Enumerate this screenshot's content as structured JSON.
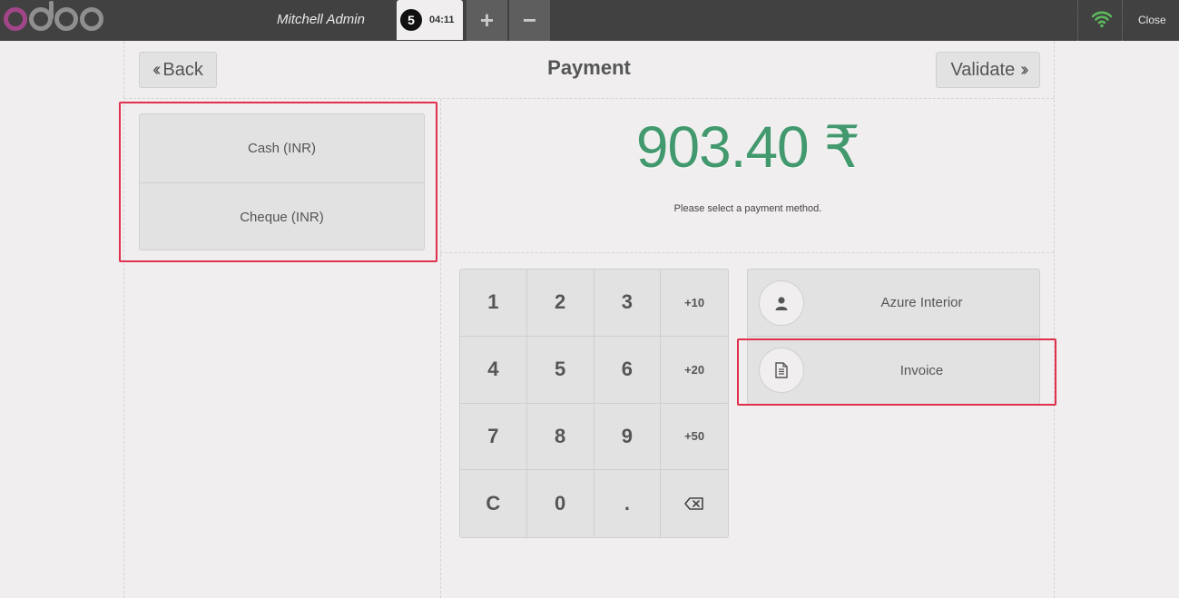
{
  "topbar": {
    "cashier": "Mitchell Admin",
    "order_sequence": "5",
    "order_time": "04:11",
    "add_label": "+",
    "remove_label": "−",
    "close_label": "Close",
    "wifi_color": "#5cb85c"
  },
  "payment": {
    "title": "Payment",
    "back_label": "Back",
    "validate_label": "Validate",
    "methods": [
      "Cash (INR)",
      "Cheque (INR)"
    ],
    "amount": "903.40 ₹",
    "help_text": "Please select a payment method.",
    "amount_color": "#43996e"
  },
  "numpad": {
    "keys": [
      "1",
      "2",
      "3",
      "+10",
      "4",
      "5",
      "6",
      "+20",
      "7",
      "8",
      "9",
      "+50",
      "C",
      "0",
      ".",
      "backspace-icon"
    ]
  },
  "side": {
    "customer_label": "Azure Interior",
    "invoice_label": "Invoice",
    "customer_icon": "user-icon",
    "invoice_icon": "document-icon"
  },
  "highlight_color": "#e0304e"
}
